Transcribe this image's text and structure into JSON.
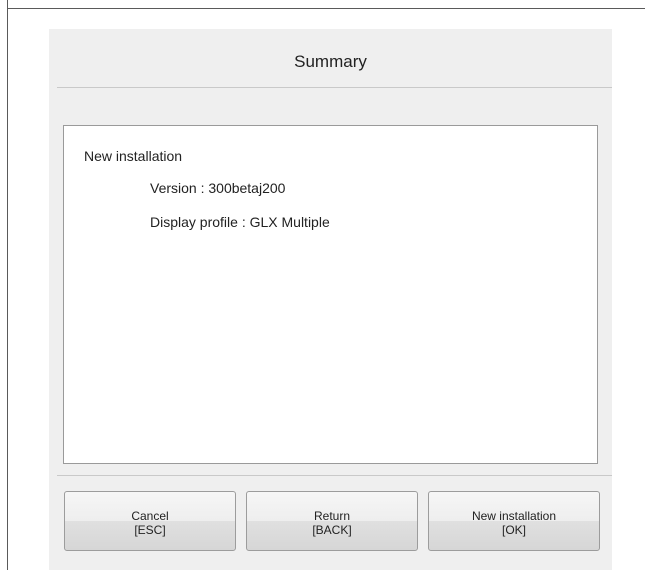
{
  "dialog": {
    "title": "Summary"
  },
  "summary": {
    "heading": "New installation",
    "version_line": "Version : 300betaj200",
    "display_profile_line": "Display profile : GLX Multiple"
  },
  "buttons": {
    "cancel": {
      "label": "Cancel",
      "shortcut": "[ESC]"
    },
    "return": {
      "label": "Return",
      "shortcut": "[BACK]"
    },
    "new_installation": {
      "label": "New installation",
      "shortcut": "[OK]"
    }
  }
}
